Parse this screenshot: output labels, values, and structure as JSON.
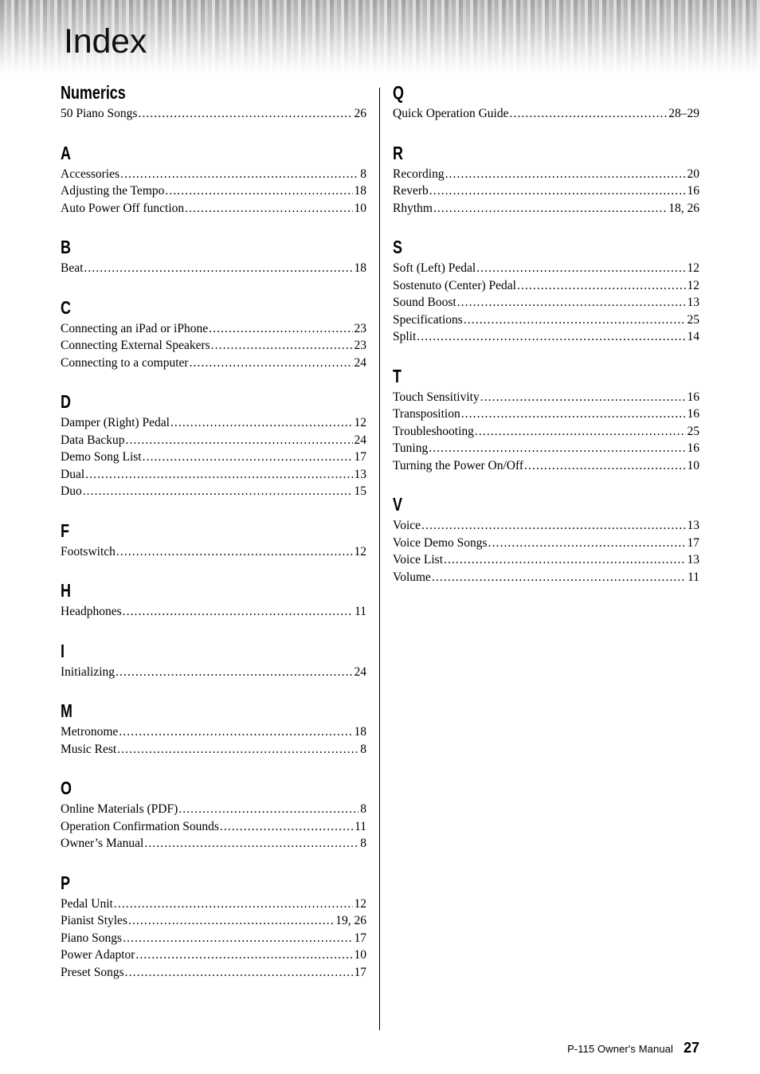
{
  "header": {
    "title": "Index"
  },
  "footer": {
    "manual": "P-115  Owner's Manual",
    "page_number": "27"
  },
  "colors": {
    "text": "#000000",
    "rule": "#000000",
    "background": "#ffffff",
    "header_stripe_dark": "#9a9a9a",
    "header_stripe_light": "#d8d8d8"
  },
  "columns": [
    {
      "name": "left-column",
      "sections": [
        {
          "letter": "Numerics",
          "entries": [
            {
              "label": "50 Piano Songs",
              "page": "26"
            }
          ]
        },
        {
          "letter": "A",
          "entries": [
            {
              "label": "Accessories",
              "page": "8"
            },
            {
              "label": "Adjusting the Tempo",
              "page": "18"
            },
            {
              "label": "Auto Power Off function",
              "page": "10"
            }
          ]
        },
        {
          "letter": "B",
          "entries": [
            {
              "label": "Beat",
              "page": "18"
            }
          ]
        },
        {
          "letter": "C",
          "entries": [
            {
              "label": "Connecting an iPad or iPhone",
              "page": "23"
            },
            {
              "label": "Connecting External Speakers",
              "page": "23"
            },
            {
              "label": "Connecting to a computer",
              "page": "24"
            }
          ]
        },
        {
          "letter": "D",
          "entries": [
            {
              "label": "Damper (Right) Pedal",
              "page": "12"
            },
            {
              "label": "Data Backup",
              "page": "24"
            },
            {
              "label": "Demo Song List",
              "page": "17"
            },
            {
              "label": "Dual",
              "page": "13"
            },
            {
              "label": "Duo",
              "page": "15"
            }
          ]
        },
        {
          "letter": "F",
          "entries": [
            {
              "label": "Footswitch",
              "page": "12"
            }
          ]
        },
        {
          "letter": "H",
          "entries": [
            {
              "label": "Headphones",
              "page": "11"
            }
          ]
        },
        {
          "letter": "I",
          "entries": [
            {
              "label": "Initializing",
              "page": "24"
            }
          ]
        },
        {
          "letter": "M",
          "entries": [
            {
              "label": "Metronome",
              "page": "18"
            },
            {
              "label": "Music Rest",
              "page": "8"
            }
          ]
        },
        {
          "letter": "O",
          "entries": [
            {
              "label": "Online Materials (PDF)",
              "page": "8"
            },
            {
              "label": "Operation Confirmation Sounds",
              "page": "11"
            },
            {
              "label": "Owner’s Manual",
              "page": "8"
            }
          ]
        },
        {
          "letter": "P",
          "entries": [
            {
              "label": "Pedal Unit",
              "page": "12"
            },
            {
              "label": "Pianist Styles",
              "page": "19, 26"
            },
            {
              "label": "Piano Songs",
              "page": "17"
            },
            {
              "label": "Power Adaptor",
              "page": "10"
            },
            {
              "label": "Preset Songs",
              "page": "17"
            }
          ]
        }
      ]
    },
    {
      "name": "right-column",
      "sections": [
        {
          "letter": "Q",
          "entries": [
            {
              "label": "Quick Operation Guide",
              "page": "28–29"
            }
          ]
        },
        {
          "letter": "R",
          "entries": [
            {
              "label": "Recording",
              "page": "20"
            },
            {
              "label": "Reverb",
              "page": "16"
            },
            {
              "label": "Rhythm",
              "page": "18, 26"
            }
          ]
        },
        {
          "letter": "S",
          "entries": [
            {
              "label": "Soft (Left) Pedal",
              "page": "12"
            },
            {
              "label": "Sostenuto (Center) Pedal",
              "page": "12"
            },
            {
              "label": "Sound Boost",
              "page": "13"
            },
            {
              "label": "Specifications",
              "page": "25"
            },
            {
              "label": "Split",
              "page": "14"
            }
          ]
        },
        {
          "letter": "T",
          "entries": [
            {
              "label": "Touch Sensitivity",
              "page": "16"
            },
            {
              "label": "Transposition",
              "page": "16"
            },
            {
              "label": "Troubleshooting",
              "page": "25"
            },
            {
              "label": "Tuning",
              "page": "16"
            },
            {
              "label": "Turning the Power On/Off",
              "page": "10"
            }
          ]
        },
        {
          "letter": "V",
          "entries": [
            {
              "label": "Voice",
              "page": "13"
            },
            {
              "label": "Voice Demo Songs",
              "page": "17"
            },
            {
              "label": "Voice List",
              "page": "13"
            },
            {
              "label": "Volume",
              "page": "11"
            }
          ]
        }
      ]
    }
  ]
}
